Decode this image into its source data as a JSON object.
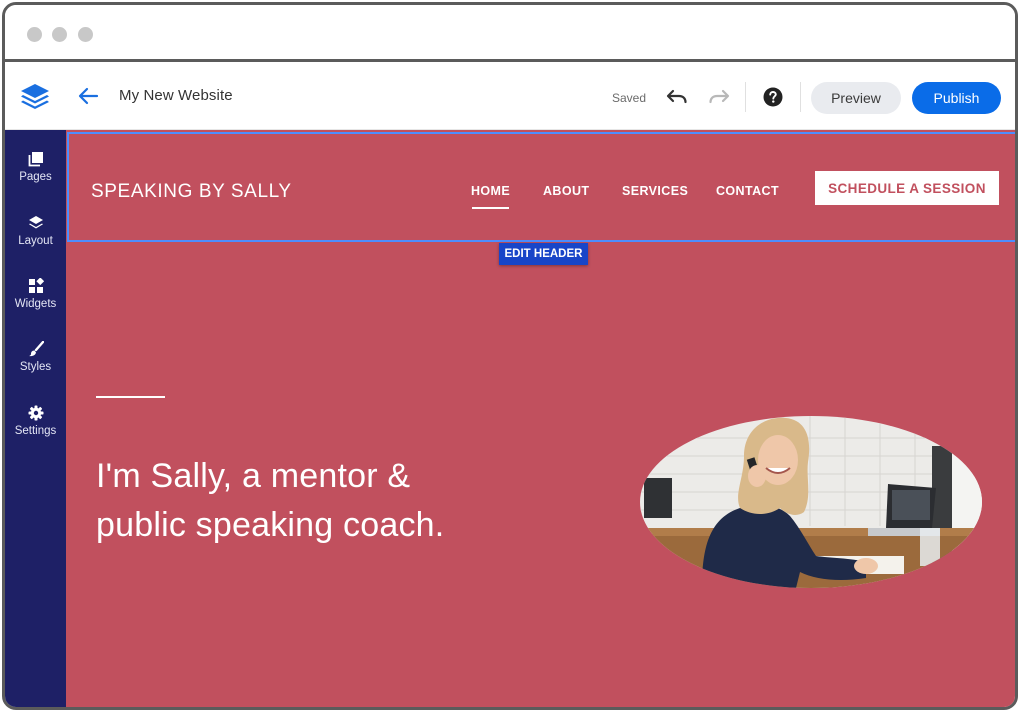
{
  "editor": {
    "site_name": "My New Website",
    "save_status": "Saved",
    "preview_label": "Preview",
    "publish_label": "Publish",
    "accent_color": "#0a6ce8"
  },
  "sidebar": {
    "items": [
      {
        "label": "Pages",
        "icon": "pages-icon"
      },
      {
        "label": "Layout",
        "icon": "layers-icon"
      },
      {
        "label": "Widgets",
        "icon": "widgets-icon"
      },
      {
        "label": "Styles",
        "icon": "brush-icon"
      },
      {
        "label": "Settings",
        "icon": "gear-icon"
      }
    ]
  },
  "site": {
    "brand": "SPEAKING BY SALLY",
    "nav": [
      "HOME",
      "ABOUT",
      "SERVICES",
      "CONTACT"
    ],
    "active_nav": "HOME",
    "cta": "SCHEDULE A SESSION",
    "edit_header_label": "EDIT HEADER",
    "hero_line1": "I'm Sally, a mentor &",
    "hero_line2": "public speaking coach.",
    "theme_color": "#c1505e"
  }
}
